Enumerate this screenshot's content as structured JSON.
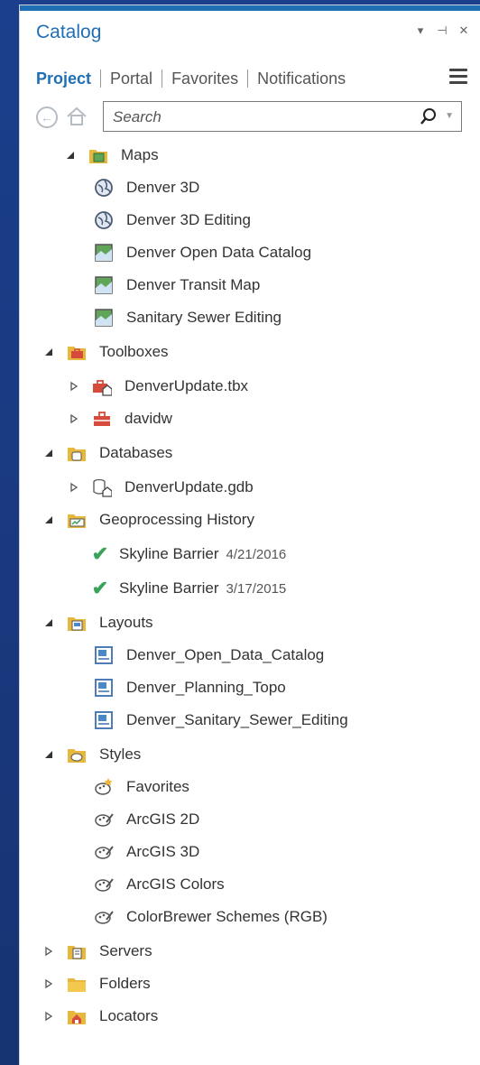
{
  "panel": {
    "title": "Catalog",
    "controls": [
      "▾",
      "⊣",
      "✕"
    ]
  },
  "tabs": [
    {
      "label": "Project",
      "active": true
    },
    {
      "label": "Portal",
      "active": false
    },
    {
      "label": "Favorites",
      "active": false
    },
    {
      "label": "Notifications",
      "active": false
    }
  ],
  "search": {
    "placeholder": "Search",
    "value": ""
  },
  "tree": {
    "maps": {
      "label": "Maps",
      "items": [
        "Denver 3D",
        "Denver 3D Editing",
        "Denver Open Data Catalog",
        "Denver Transit Map",
        "Sanitary Sewer Editing"
      ]
    },
    "toolboxes": {
      "label": "Toolboxes",
      "items": [
        "DenverUpdate.tbx",
        "davidw"
      ]
    },
    "databases": {
      "label": "Databases",
      "items": [
        "DenverUpdate.gdb"
      ]
    },
    "history": {
      "label": "Geoprocessing History",
      "items": [
        {
          "label": "Skyline Barrier",
          "date": "4/21/2016"
        },
        {
          "label": "Skyline Barrier",
          "date": "3/17/2015"
        }
      ]
    },
    "layouts": {
      "label": "Layouts",
      "items": [
        "Denver_Open_Data_Catalog",
        "Denver_Planning_Topo",
        "Denver_Sanitary_Sewer_Editing"
      ]
    },
    "styles": {
      "label": "Styles",
      "items": [
        "Favorites",
        "ArcGIS 2D",
        "ArcGIS 3D",
        "ArcGIS Colors",
        "ColorBrewer Schemes (RGB)"
      ]
    },
    "servers": {
      "label": "Servers"
    },
    "folders": {
      "label": "Folders"
    },
    "locators": {
      "label": "Locators"
    }
  },
  "colors": {
    "accent": "#1f6fb5",
    "background": "#1a3a82",
    "check": "#3aa35b",
    "folder": "#e8b83c"
  }
}
